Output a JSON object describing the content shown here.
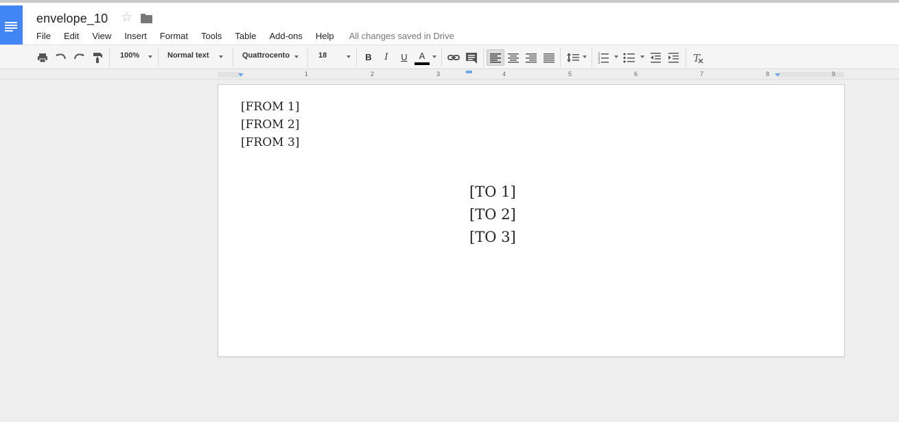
{
  "document": {
    "title": "envelope_10",
    "save_status": "All changes saved in Drive"
  },
  "menu": [
    "File",
    "Edit",
    "View",
    "Insert",
    "Format",
    "Tools",
    "Table",
    "Add-ons",
    "Help"
  ],
  "toolbar": {
    "zoom": "100%",
    "style": "Normal text",
    "font": "Quattrocento",
    "font_size": "18",
    "bold": "B",
    "italic": "I",
    "underline": "U",
    "text_color_letter": "A",
    "text_color": "#000000"
  },
  "ruler": {
    "numbers": [
      "1",
      "2",
      "3",
      "4",
      "5",
      "6",
      "7",
      "8",
      "9"
    ]
  },
  "body": {
    "from_lines": [
      "[FROM 1]",
      "[FROM 2]",
      "[FROM 3]"
    ],
    "to_lines": [
      "[TO 1]",
      "[TO 2]",
      "[TO 3]"
    ]
  },
  "colors": {
    "brand": "#4285f4"
  }
}
